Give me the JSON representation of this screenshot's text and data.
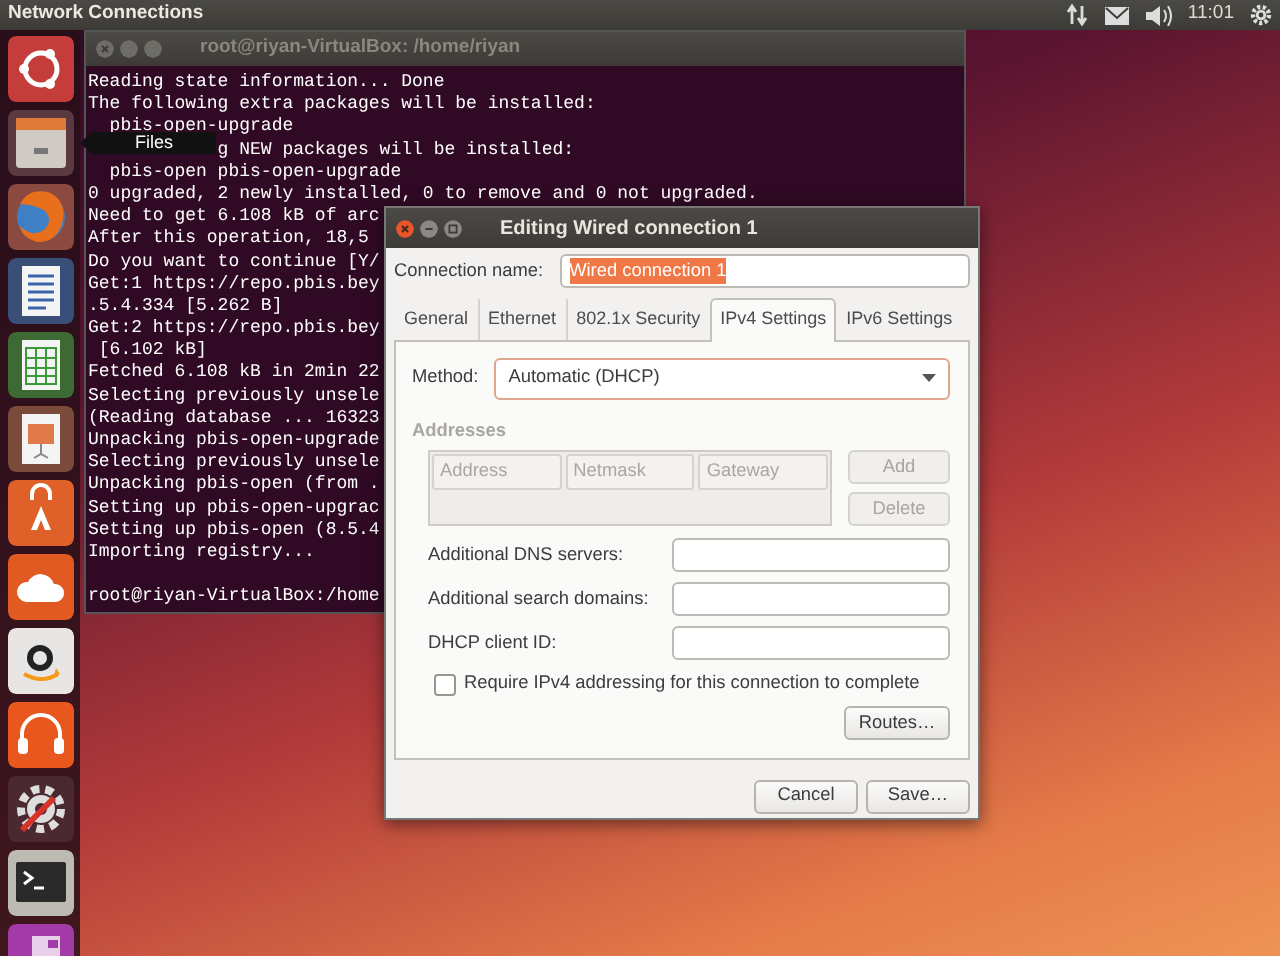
{
  "top_panel": {
    "title": "Network Connections",
    "clock": "11:01"
  },
  "launcher_tooltip": "Files",
  "terminal": {
    "title": "root@riyan-VirtualBox: /home/riyan",
    "lines": [
      {
        "kind": "plain",
        "text": "Reading state information... Done"
      },
      {
        "kind": "plain",
        "text": "The following extra packages will be installed:"
      },
      {
        "kind": "plain",
        "text": "  pbis-open-upgrade"
      },
      {
        "kind": "behind_tooltip",
        "text": "g NEW packages will be installed:"
      },
      {
        "kind": "plain",
        "text": "  pbis-open pbis-open-upgrade"
      },
      {
        "kind": "plain",
        "text": "0 upgraded, 2 newly installed, 0 to remove and 0 not upgraded."
      },
      {
        "kind": "plain",
        "text": "Need to get 6.108 kB of arc"
      },
      {
        "kind": "plain",
        "text": "After this operation, 18,5"
      },
      {
        "kind": "plain",
        "text": "Do you want to continue [Y/"
      },
      {
        "kind": "plain",
        "text": "Get:1 https://repo.pbis.bey"
      },
      {
        "kind": "plain",
        "text": ".5.4.334 [5.262 B]"
      },
      {
        "kind": "plain",
        "text": "Get:2 https://repo.pbis.bey"
      },
      {
        "kind": "plain",
        "text": " [6.102 kB]"
      },
      {
        "kind": "plain",
        "text": "Fetched 6.108 kB in 2min 22"
      },
      {
        "kind": "plain",
        "text": "Selecting previously unsele"
      },
      {
        "kind": "plain",
        "text": "(Reading database ... 16323"
      },
      {
        "kind": "plain",
        "text": "Unpacking pbis-open-upgrade"
      },
      {
        "kind": "plain",
        "text": "Selecting previously unsele"
      },
      {
        "kind": "plain",
        "text": "Unpacking pbis-open (from ."
      },
      {
        "kind": "plain",
        "text": "Setting up pbis-open-upgrac"
      },
      {
        "kind": "plain",
        "text": "Setting up pbis-open (8.5.4"
      },
      {
        "kind": "plain",
        "text": "Importing registry..."
      },
      {
        "kind": "blank"
      },
      {
        "kind": "plain",
        "text": "root@riyan-VirtualBox:/home"
      }
    ]
  },
  "dialog": {
    "title": "Editing Wired connection 1",
    "connection_name": {
      "label": "Connection name:",
      "value": "Wired connection 1",
      "selected": true
    },
    "tabs": [
      {
        "label": "General",
        "selected": false
      },
      {
        "label": "Ethernet",
        "selected": false
      },
      {
        "label": "802.1x Security",
        "selected": false
      },
      {
        "label": "IPv4 Settings",
        "selected": true
      },
      {
        "label": "IPv6 Settings",
        "selected": false
      }
    ],
    "method": {
      "label": "Method:",
      "value": "Automatic (DHCP)"
    },
    "addresses": {
      "label": "Addresses",
      "disabled": true,
      "columns": [
        "Address",
        "Netmask",
        "Gateway"
      ],
      "buttons": [
        {
          "label": "Add",
          "disabled": true
        },
        {
          "label": "Delete",
          "disabled": true
        }
      ]
    },
    "fields": [
      {
        "label": "Additional DNS servers:"
      },
      {
        "label": "Additional search domains:"
      },
      {
        "label": "DHCP client ID:"
      }
    ],
    "require_checkbox": {
      "label": "Require IPv4 addressing for this connection to complete",
      "checked": false
    },
    "routes_button": "Routes…",
    "buttons": [
      "Cancel",
      "Save…"
    ]
  }
}
